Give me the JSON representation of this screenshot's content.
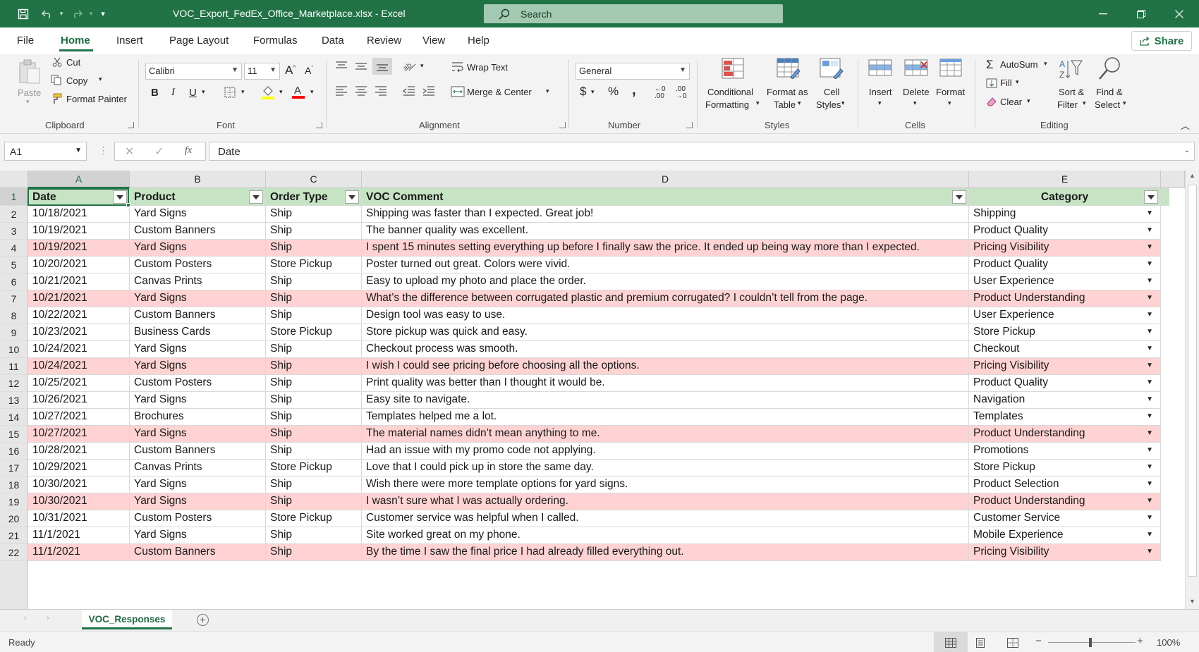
{
  "title_bar": {
    "file_title": "VOC_Export_FedEx_Office_Marketplace.xlsx  -  Excel",
    "search_placeholder": "Search"
  },
  "ribbon_tabs": [
    "File",
    "Home",
    "Insert",
    "Page Layout",
    "Formulas",
    "Data",
    "Review",
    "View",
    "Help"
  ],
  "share_label": "Share",
  "clipboard": {
    "paste": "Paste",
    "cut": "Cut",
    "copy": "Copy",
    "format_painter": "Format Painter",
    "group": "Clipboard"
  },
  "font": {
    "name": "Calibri",
    "size": "11",
    "group": "Font",
    "fill_color": "#FFFF00",
    "font_color": "#FF0000"
  },
  "alignment": {
    "wrap_text": "Wrap Text",
    "merge_center": "Merge & Center",
    "group": "Alignment"
  },
  "number": {
    "format": "General",
    "group": "Number"
  },
  "styles": {
    "conditional_formatting_1": "Conditional",
    "conditional_formatting_2": "Formatting",
    "format_as_table_1": "Format as",
    "format_as_table_2": "Table",
    "cell_styles_1": "Cell",
    "cell_styles_2": "Styles",
    "group": "Styles"
  },
  "cells_group": {
    "insert": "Insert",
    "delete": "Delete",
    "format": "Format",
    "group": "Cells"
  },
  "editing": {
    "autosum": "AutoSum",
    "fill": "Fill",
    "clear": "Clear",
    "sort_filter_1": "Sort &",
    "sort_filter_2": "Filter",
    "find_select_1": "Find &",
    "find_select_2": "Select",
    "group": "Editing"
  },
  "formula_bar": {
    "name_box": "A1",
    "fx": "fx",
    "content": "Date"
  },
  "columns": [
    "A",
    "B",
    "C",
    "D",
    "E"
  ],
  "headers": [
    "Date",
    "Product",
    "Order Type",
    "VOC Comment",
    "Category"
  ],
  "rows": [
    {
      "n": "2",
      "date": "10/18/2021",
      "product": "Yard Signs",
      "order": "Ship",
      "comment": "Shipping was faster than I expected. Great job!",
      "category": "Shipping",
      "hl": false
    },
    {
      "n": "3",
      "date": "10/19/2021",
      "product": "Custom Banners",
      "order": "Ship",
      "comment": "The banner quality was excellent.",
      "category": "Product Quality",
      "hl": false
    },
    {
      "n": "4",
      "date": "10/19/2021",
      "product": "Yard Signs",
      "order": "Ship",
      "comment": "I spent 15 minutes setting everything up before I finally saw the price. It ended up being way more than I expected.",
      "category": "Pricing Visibility",
      "hl": true
    },
    {
      "n": "5",
      "date": "10/20/2021",
      "product": "Custom Posters",
      "order": "Store Pickup",
      "comment": "Poster turned out great. Colors were vivid.",
      "category": "Product Quality",
      "hl": false
    },
    {
      "n": "6",
      "date": "10/21/2021",
      "product": "Canvas Prints",
      "order": "Ship",
      "comment": "Easy to upload my photo and place the order.",
      "category": "User Experience",
      "hl": false
    },
    {
      "n": "7",
      "date": "10/21/2021",
      "product": "Yard Signs",
      "order": "Ship",
      "comment": "What’s the difference between corrugated plastic and premium corrugated? I couldn’t tell from the page.",
      "category": "Product Understanding",
      "hl": true
    },
    {
      "n": "8",
      "date": "10/22/2021",
      "product": "Custom Banners",
      "order": "Ship",
      "comment": "Design tool was easy to use.",
      "category": "User Experience",
      "hl": false
    },
    {
      "n": "9",
      "date": "10/23/2021",
      "product": "Business Cards",
      "order": "Store Pickup",
      "comment": "Store pickup was quick and easy.",
      "category": "Store Pickup",
      "hl": false
    },
    {
      "n": "10",
      "date": "10/24/2021",
      "product": "Yard Signs",
      "order": "Ship",
      "comment": "Checkout process was smooth.",
      "category": "Checkout",
      "hl": false
    },
    {
      "n": "11",
      "date": "10/24/2021",
      "product": "Yard Signs",
      "order": "Ship",
      "comment": "I wish I could see pricing before choosing all the options.",
      "category": "Pricing Visibility",
      "hl": true
    },
    {
      "n": "12",
      "date": "10/25/2021",
      "product": "Custom Posters",
      "order": "Ship",
      "comment": "Print quality was better than I thought it would be.",
      "category": "Product Quality",
      "hl": false
    },
    {
      "n": "13",
      "date": "10/26/2021",
      "product": "Yard Signs",
      "order": "Ship",
      "comment": "Easy site to navigate.",
      "category": "Navigation",
      "hl": false
    },
    {
      "n": "14",
      "date": "10/27/2021",
      "product": "Brochures",
      "order": "Ship",
      "comment": "Templates helped me a lot.",
      "category": "Templates",
      "hl": false
    },
    {
      "n": "15",
      "date": "10/27/2021",
      "product": "Yard Signs",
      "order": "Ship",
      "comment": "The material names didn’t mean anything to me.",
      "category": "Product Understanding",
      "hl": true
    },
    {
      "n": "16",
      "date": "10/28/2021",
      "product": "Custom Banners",
      "order": "Ship",
      "comment": "Had an issue with my promo code not applying.",
      "category": "Promotions",
      "hl": false
    },
    {
      "n": "17",
      "date": "10/29/2021",
      "product": "Canvas Prints",
      "order": "Store Pickup",
      "comment": "Love that I could pick up in store the same day.",
      "category": "Store Pickup",
      "hl": false
    },
    {
      "n": "18",
      "date": "10/30/2021",
      "product": "Yard Signs",
      "order": "Ship",
      "comment": "Wish there were more template options for yard signs.",
      "category": "Product Selection",
      "hl": false
    },
    {
      "n": "19",
      "date": "10/30/2021",
      "product": "Yard Signs",
      "order": "Ship",
      "comment": "I wasn’t sure what I was actually ordering.",
      "category": "Product Understanding",
      "hl": true
    },
    {
      "n": "20",
      "date": "10/31/2021",
      "product": "Custom Posters",
      "order": "Store Pickup",
      "comment": "Customer service was helpful when I called.",
      "category": "Customer Service",
      "hl": false
    },
    {
      "n": "21",
      "date": "11/1/2021",
      "product": "Yard Signs",
      "order": "Ship",
      "comment": "Site worked great on my phone.",
      "category": "Mobile Experience",
      "hl": false
    },
    {
      "n": "22",
      "date": "11/1/2021",
      "product": "Custom Banners",
      "order": "Ship",
      "comment": "By the time I saw the final price I had already filled everything out.",
      "category": "Pricing Visibility",
      "hl": true
    }
  ],
  "sheet_tab": "VOC_Responses",
  "status": {
    "ready": "Ready",
    "zoom": "100%"
  },
  "colors": {
    "excel_green": "#217346",
    "header_fill": "#C6E4C4",
    "highlight_fill": "#FFD3D3"
  }
}
